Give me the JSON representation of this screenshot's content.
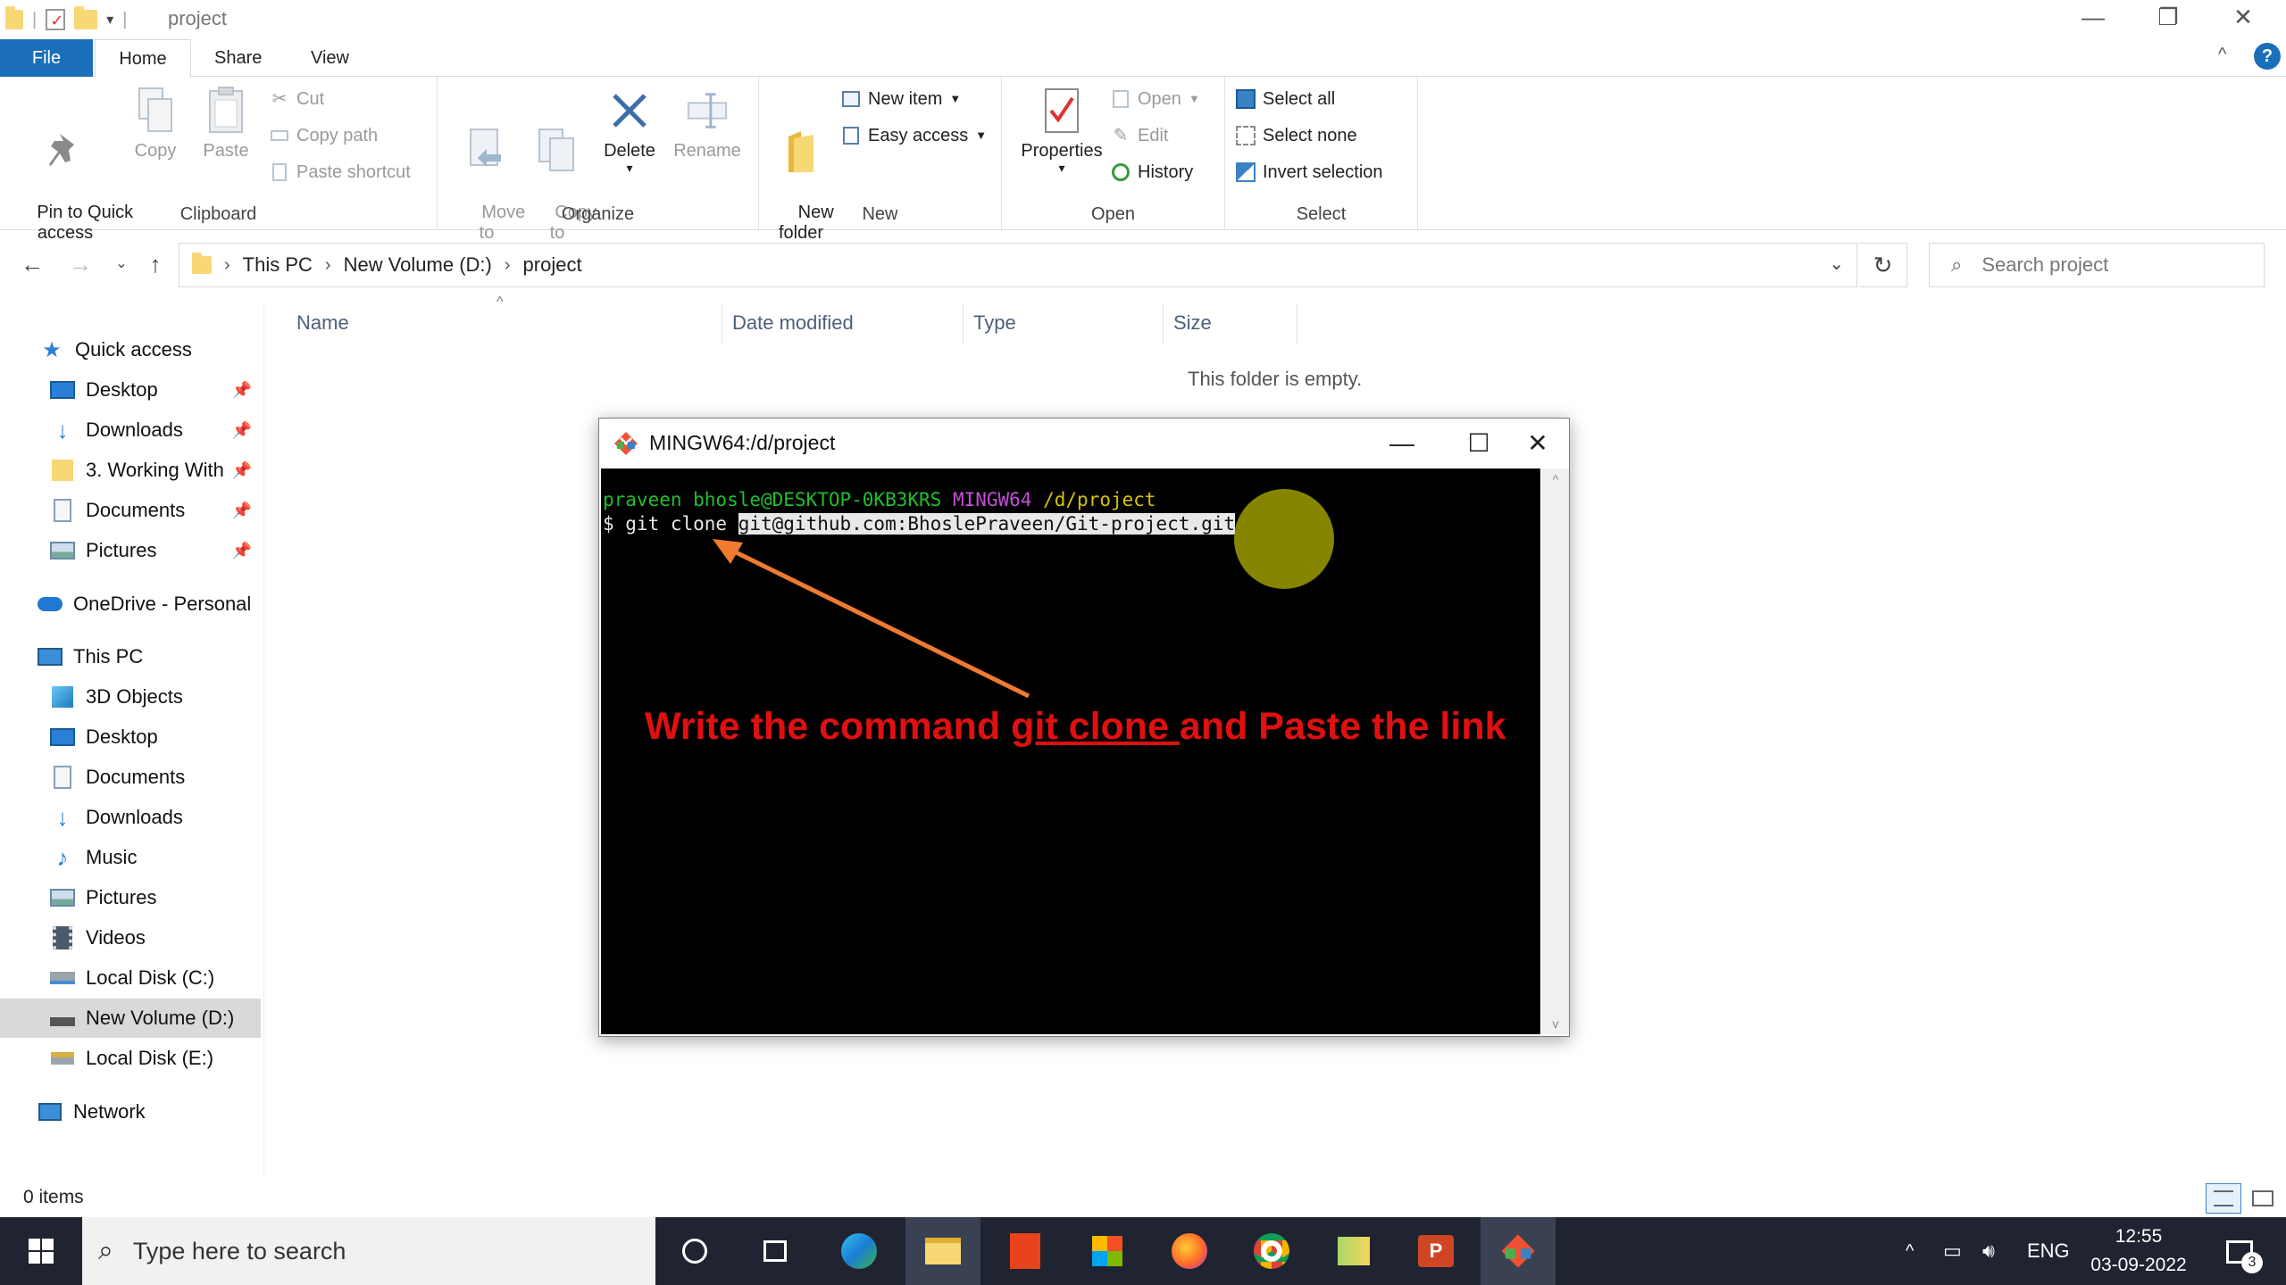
{
  "window": {
    "title": "project"
  },
  "ribbon_tabs": [
    "File",
    "Home",
    "Share",
    "View"
  ],
  "ribbon": {
    "clipboard": {
      "pin_label": "Pin to Quick\naccess",
      "copy_label": "Copy",
      "paste_label": "Paste",
      "cut_label": "Cut",
      "copy_path_label": "Copy path",
      "paste_shortcut_label": "Paste shortcut",
      "group_label": "Clipboard"
    },
    "organize": {
      "move_to_label": "Move\nto",
      "copy_to_label": "Copy\nto",
      "delete_label": "Delete",
      "rename_label": "Rename",
      "group_label": "Organize"
    },
    "new": {
      "new_folder_label": "New\nfolder",
      "new_item_label": "New item",
      "easy_access_label": "Easy access",
      "group_label": "New"
    },
    "open": {
      "properties_label": "Properties",
      "open_label": "Open",
      "edit_label": "Edit",
      "history_label": "History",
      "group_label": "Open"
    },
    "select": {
      "select_all_label": "Select all",
      "select_none_label": "Select none",
      "invert_label": "Invert selection",
      "group_label": "Select"
    }
  },
  "address": {
    "crumbs": [
      "This PC",
      "New Volume (D:)",
      "project"
    ],
    "search_placeholder": "Search project"
  },
  "nav": {
    "quick_access": "Quick access",
    "quick_items": [
      "Desktop",
      "Downloads",
      "3. Working With",
      "Documents",
      "Pictures"
    ],
    "onedrive": "OneDrive - Personal",
    "this_pc": "This PC",
    "pc_items": [
      "3D Objects",
      "Desktop",
      "Documents",
      "Downloads",
      "Music",
      "Pictures",
      "Videos",
      "Local Disk (C:)",
      "New Volume (D:)",
      "Local Disk (E:)"
    ],
    "network": "Network"
  },
  "columns": [
    "Name",
    "Date modified",
    "Type",
    "Size"
  ],
  "empty_message": "This folder is empty.",
  "status": {
    "item_count": "0 items"
  },
  "terminal": {
    "title": "MINGW64:/d/project",
    "prompt_user": "praveen bhosle@DESKTOP-0KB3KRS",
    "prompt_env": "MINGW64",
    "prompt_path": "/d/project",
    "command_prefix": "$ git clone ",
    "command_url": "git@github.com:BhoslePraveen/Git-project.git"
  },
  "annotation": {
    "before": "Write the command ",
    "highlight": "git clone ",
    "after": "and Paste the link",
    "color": "#e01010"
  },
  "taskbar": {
    "search_placeholder": "Type here to search",
    "language": "ENG",
    "time": "12:55",
    "date": "03-09-2022",
    "notification_count": "3"
  }
}
